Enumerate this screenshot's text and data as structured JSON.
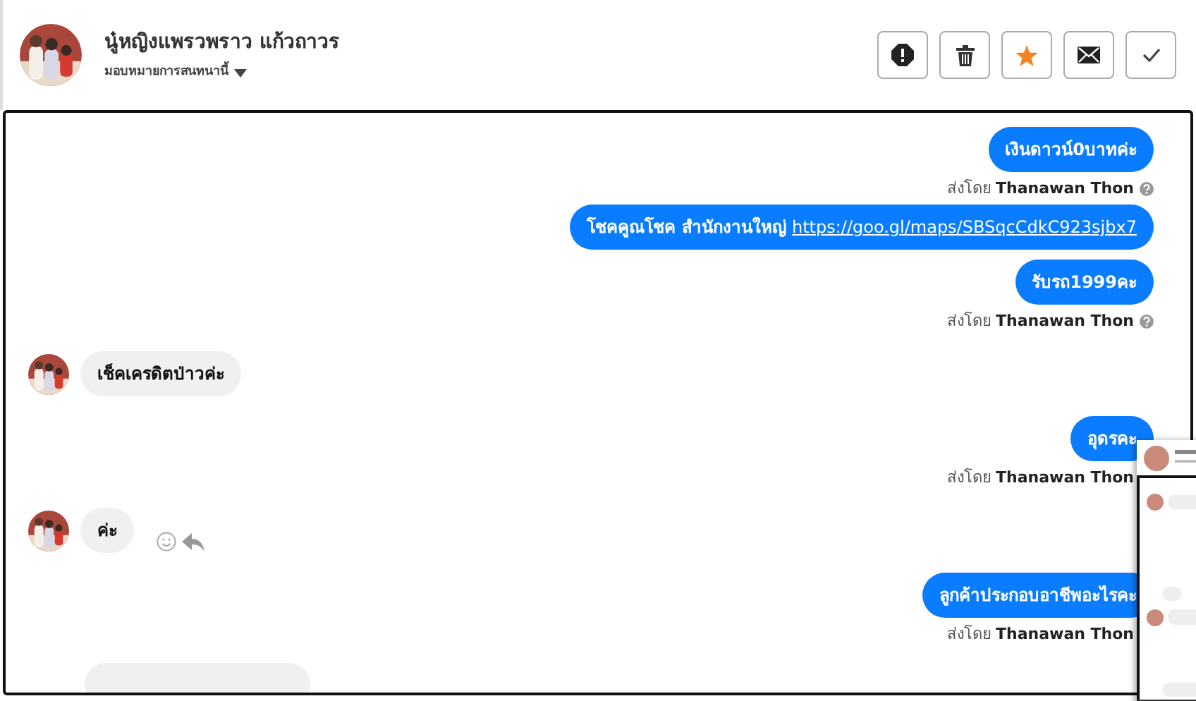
{
  "header": {
    "name": "นู๋หญิงแพรวพราว แก้วถาวร",
    "assign_label": "มอบหมายการสนทนานี้",
    "buttons": [
      {
        "kind": "alert"
      },
      {
        "kind": "trash"
      },
      {
        "kind": "star"
      },
      {
        "kind": "mail"
      },
      {
        "kind": "check"
      }
    ]
  },
  "messages": [
    {
      "kind": "out",
      "text": "เงินดาวน์0บาทค่ะ"
    },
    {
      "kind": "meta",
      "text": "ส่งโดย **Thanawan Thon**",
      "help_icon": true
    },
    {
      "kind": "out",
      "text": "โชคคูณโชค สำนักงานใหญ่",
      "link": "https://goo.gl/maps/SBSqcCdkC923sjbx7"
    },
    {
      "kind": "out",
      "text": "รับรถ1999คะ"
    },
    {
      "kind": "meta",
      "text": "ส่งโดย **Thanawan Thon**",
      "help_icon": true
    },
    {
      "kind": "in",
      "text": "เช็คเครดิตป่าวค่ะ",
      "reactions": false
    },
    {
      "kind": "out",
      "text": "อุดรคะ"
    },
    {
      "kind": "meta",
      "text": "ส่งโดย **Thanawan Thon**"
    },
    {
      "kind": "in",
      "text": "ค่ะ",
      "reactions": true
    },
    {
      "kind": "out",
      "text": "ลูกค้าประกอบอาชีพอะไรคะ"
    },
    {
      "kind": "meta",
      "text": "ส่งโดย **Thanawan Thon**"
    },
    {
      "kind": "in_partial"
    }
  ]
}
